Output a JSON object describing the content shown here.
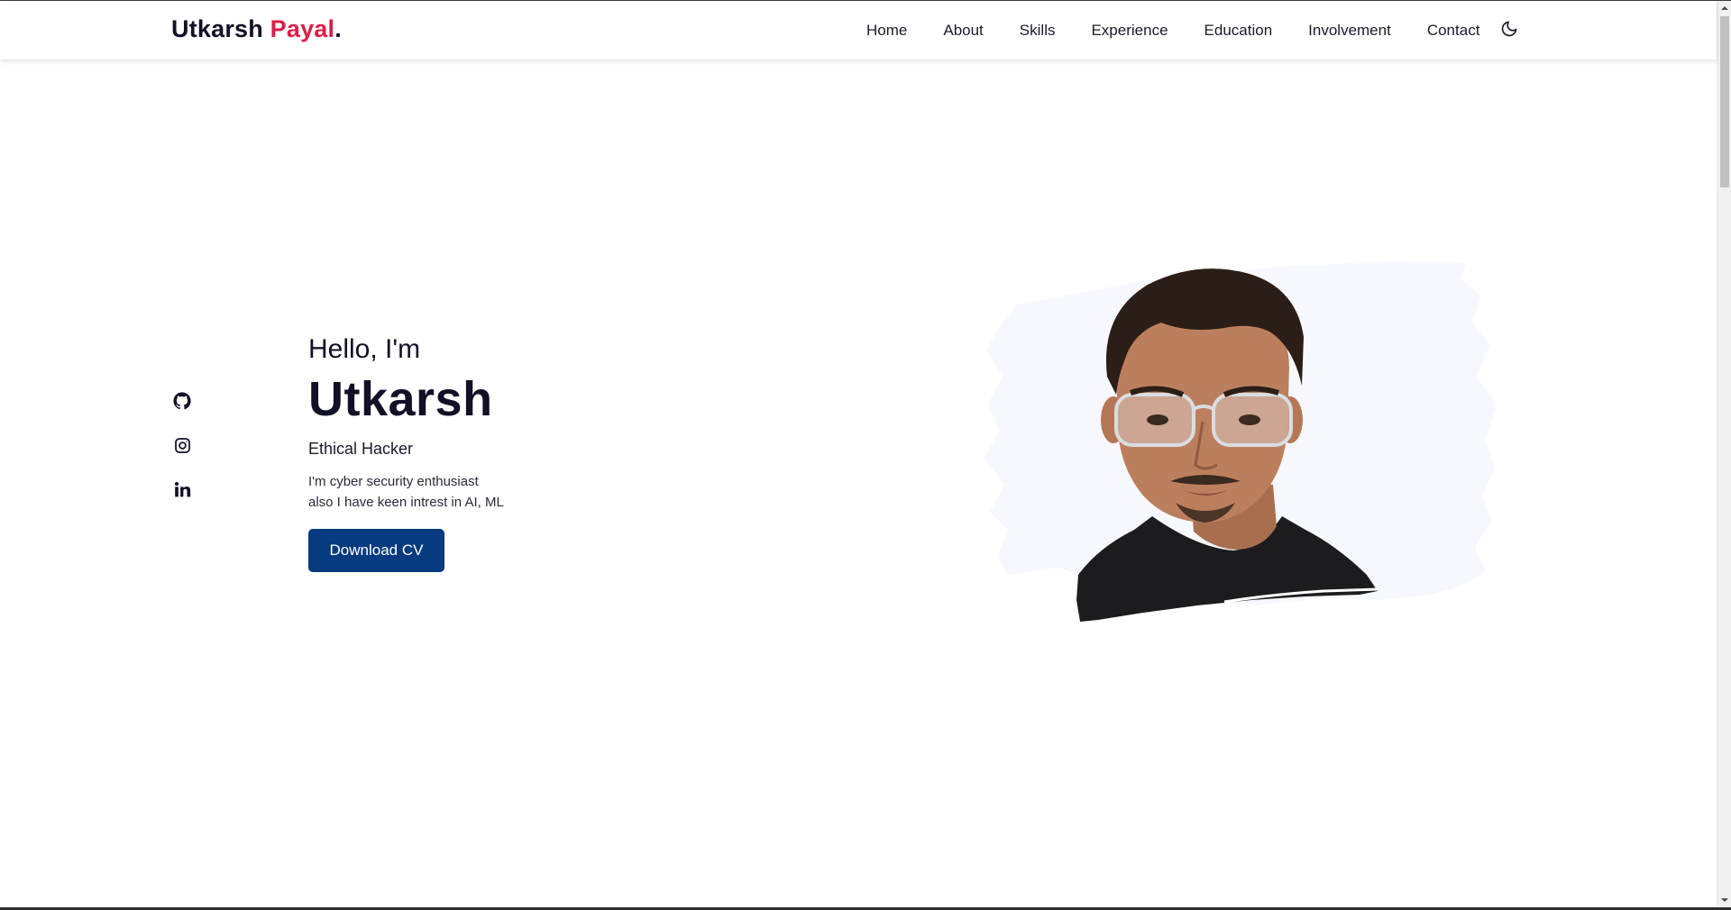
{
  "header": {
    "logo": {
      "first": "Utkarsh",
      "last": "Payal",
      "dot": "."
    },
    "nav": [
      "Home",
      "About",
      "Skills",
      "Experience",
      "Education",
      "Involvement",
      "Contact"
    ],
    "theme_icon": "moon-icon"
  },
  "socials": [
    {
      "name": "github",
      "icon": "github-icon"
    },
    {
      "name": "instagram",
      "icon": "instagram-icon"
    },
    {
      "name": "linkedin",
      "icon": "linkedin-icon"
    }
  ],
  "hero": {
    "greeting": "Hello, I'm",
    "name": "Utkarsh",
    "role": "Ethical Hacker",
    "desc_line1": "I'm cyber security enthusiast",
    "desc_line2": "also I have keen intrest in AI, ML",
    "cta": "Download CV"
  },
  "colors": {
    "accent": "#dc1e46",
    "button": "#073a7e",
    "text": "#111026",
    "photo_backdrop": "#f6f8fd"
  }
}
